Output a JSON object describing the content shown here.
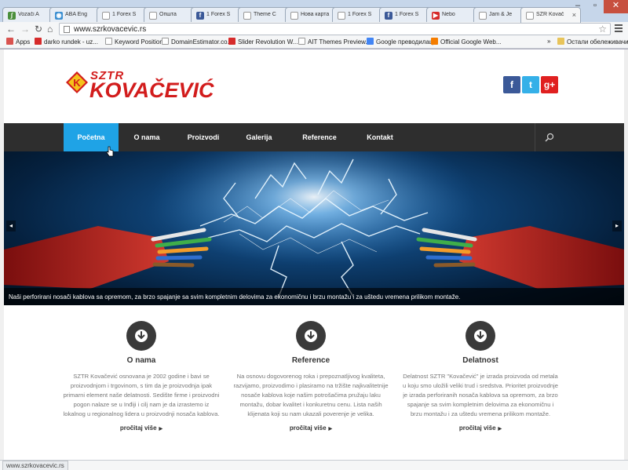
{
  "browser": {
    "tabs": [
      {
        "label": "Vozači A",
        "icon_color": "#4a8f3b",
        "icon": "leaf"
      },
      {
        "label": "ABA Eng",
        "icon_color": "#3b8fd1",
        "icon": "globe"
      },
      {
        "label": "1 Forex S",
        "icon_color": "#bbbbbb",
        "icon": "page"
      },
      {
        "label": "Општа",
        "icon_color": "#bbbbbb",
        "icon": "page"
      },
      {
        "label": "1 Forex S",
        "icon_color": "#3b5998",
        "icon": "facebook"
      },
      {
        "label": "Theme C",
        "icon_color": "#bbbbbb",
        "icon": "page"
      },
      {
        "label": "Нова карта",
        "icon_color": "#bbbbbb",
        "icon": "page"
      },
      {
        "label": "1 Forex S",
        "icon_color": "#bbbbbb",
        "icon": "page"
      },
      {
        "label": "1 Forex S",
        "icon_color": "#3b5998",
        "icon": "facebook"
      },
      {
        "label": "Nebo",
        "icon_color": "#d62b2b",
        "icon": "youtube"
      },
      {
        "label": "Jam & Je",
        "icon_color": "#bbbbbb",
        "icon": "page"
      },
      {
        "label": "SZR Kovač",
        "icon_color": "#bbbbbb",
        "icon": "page",
        "active": true
      }
    ],
    "url": "www.szrkovacevic.rs",
    "bookmarks": [
      {
        "label": "Apps",
        "icon_color": "#d9534f"
      },
      {
        "label": "darko rundek - uz...",
        "icon_color": "#d62b2b"
      },
      {
        "label": "Keyword Position",
        "icon_color": "#bbbbbb"
      },
      {
        "label": "DomainEstimator.co...",
        "icon_color": "#bbbbbb"
      },
      {
        "label": "Slider Revolution W...",
        "icon_color": "#d62b2b"
      },
      {
        "label": "AIT Themes Preview...",
        "icon_color": "#bbbbbb"
      },
      {
        "label": "Google преводилац",
        "icon_color": "#4285f4"
      },
      {
        "label": "Official Google Web...",
        "icon_color": "#f57d00"
      }
    ],
    "bookmarks_more": "»",
    "other_bookmarks": "Остали обележивачи",
    "status_url": "www.szrkovacevic.rs"
  },
  "site": {
    "logo": {
      "sztr": "SZTR",
      "name": "KOVAČEVIĆ",
      "badge_letter": "K"
    },
    "social": [
      {
        "label": "f",
        "color": "#3b5998"
      },
      {
        "label": "t",
        "color": "#35b0e8"
      },
      {
        "label": "g+",
        "color": "#e02020"
      }
    ],
    "nav": [
      "Početna",
      "O nama",
      "Proizvodi",
      "Galerija",
      "Reference",
      "Kontakt"
    ],
    "hero_caption": "Naši perforirani nosači kablova sa opremom, za brzo spajanje sa svim kompletnim delovima za ekonomičnu i brzu montažu i za uštedu vremena prilikom montaže.",
    "features": [
      {
        "title": "O nama",
        "text": "SZTR Kovačević osnovana je 2002 godine i bavi se proizvodnjom i trgovinom, s tim da je proizvodnja ipak primarni element naše delatnosti. Sedište firme i proizvodni pogon nalaze se u Inđiji i cilj nam je da izrastemo iz lokalnog u regionalnog lidera u proizvodnji nosača kablova.",
        "more": "pročitaj više"
      },
      {
        "title": "Reference",
        "text": "Na osnovu dogovorenog roka i prepoznatljivog kvaliteta, razvijamo, proizvodimo i plasiramo na tržište najkvalitetnije nosače kablova koje našim potrošačima pružaju laku montažu, dobar kvalitet i konkuretnu cenu. Lista naših klijenata koji su nam ukazali poverenje je velika.",
        "more": "pročitaj više"
      },
      {
        "title": "Delatnost",
        "text": "Delatnost SZTR \"Kovačević\" je izrada proizvoda od metala u koju smo uložili veliki trud i sredstva. Prioritet proizvodnje je izrada perforiranih nosača kablova sa opremom, za brzo spajanje sa svim kompletnim delovima za ekonomičnu i brzu montažu i za uštedu vremena prilikom montaže.",
        "more": "pročitaj više"
      }
    ],
    "colors": {
      "brand_red": "#d21c1c",
      "accent_blue": "#1fa3e6",
      "nav_dark": "#2e2e2e"
    }
  }
}
